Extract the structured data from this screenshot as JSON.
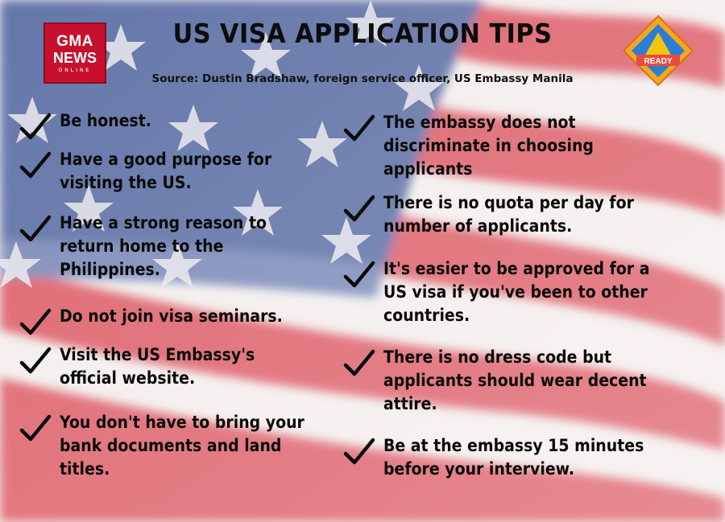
{
  "title": "US VISA APPLICATION TIPS",
  "source": "Source: Dustin Bradshaw, foreign service officer, US Embassy Manila",
  "logos": {
    "left": {
      "line1": "GMA",
      "line2": "NEWS",
      "line3": "ONLINE",
      "color": "#c8102e"
    },
    "right": {
      "label": "READY",
      "color": "#f39c12"
    }
  },
  "colors": {
    "flag_red": "#d94b57",
    "flag_blue": "#4a5f9a",
    "text": "#0a0a0a"
  },
  "tips_left": [
    "Be honest.",
    "Have a good purpose for\nvisiting the US.",
    "Have a strong reason to\nreturn home to the\nPhilippines.",
    "Do not join visa seminars.",
    "Visit the US Embassy's\nofficial website.",
    "You don't have to bring your\nbank documents and land\ntitles."
  ],
  "tips_right": [
    "The embassy does not\ndiscriminate in choosing\napplicants",
    "There is no quota per day for\nnumber of applicants.",
    "It's easier to be approved for a\nUS visa if you've been to other\ncountries.",
    "There is no dress code but\napplicants should wear decent\nattire.",
    "Be at the embassy 15 minutes\nbefore your interview."
  ],
  "icons": {
    "check": "checkmark-icon",
    "star": "star-icon"
  }
}
